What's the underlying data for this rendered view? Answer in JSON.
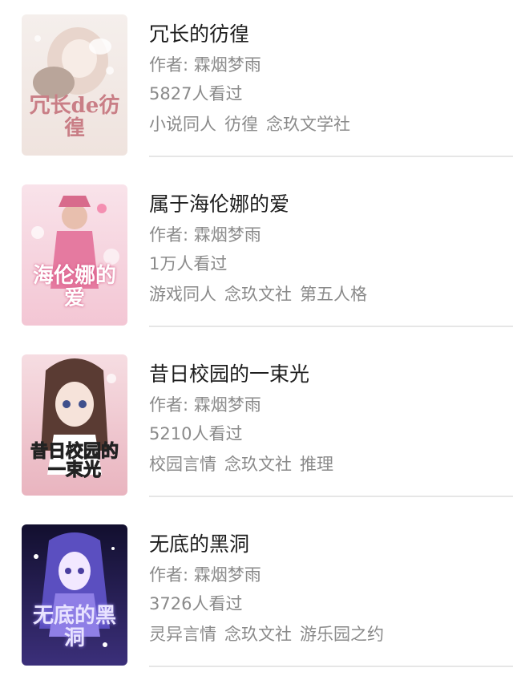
{
  "books": [
    {
      "title": "冗长的彷徨",
      "author": "作者: 霖烟梦雨",
      "views": "5827人看过",
      "tags": [
        "小说同人",
        "彷徨",
        "念玖文学社"
      ],
      "cover_text": "冗长de彷徨",
      "cover_colors": [
        "#f3ece8",
        "#d9c6bf",
        "#c98a8a"
      ]
    },
    {
      "title": "属于海伦娜的爱",
      "author": "作者: 霖烟梦雨",
      "views": "1万人看过",
      "tags": [
        "游戏同人",
        "念玖文社",
        "第五人格"
      ],
      "cover_text": "海伦娜的爱",
      "cover_colors": [
        "#f7dfe6",
        "#ef9fb8",
        "#ffffff"
      ]
    },
    {
      "title": "昔日校园的一束光",
      "author": "作者: 霖烟梦雨",
      "views": "5210人看过",
      "tags": [
        "校园言情",
        "念玖文社",
        "推理"
      ],
      "cover_text": "昔日校园的一束光",
      "cover_colors": [
        "#f4d3d9",
        "#6b4a42",
        "#1a1a1a"
      ]
    },
    {
      "title": "无底的黑洞",
      "author": "作者: 霖烟梦雨",
      "views": "3726人看过",
      "tags": [
        "灵异言情",
        "念玖文社",
        "游乐园之约"
      ],
      "cover_text": "无底的黑洞",
      "cover_colors": [
        "#1c1740",
        "#6a5acd",
        "#dcd6ff"
      ]
    }
  ]
}
